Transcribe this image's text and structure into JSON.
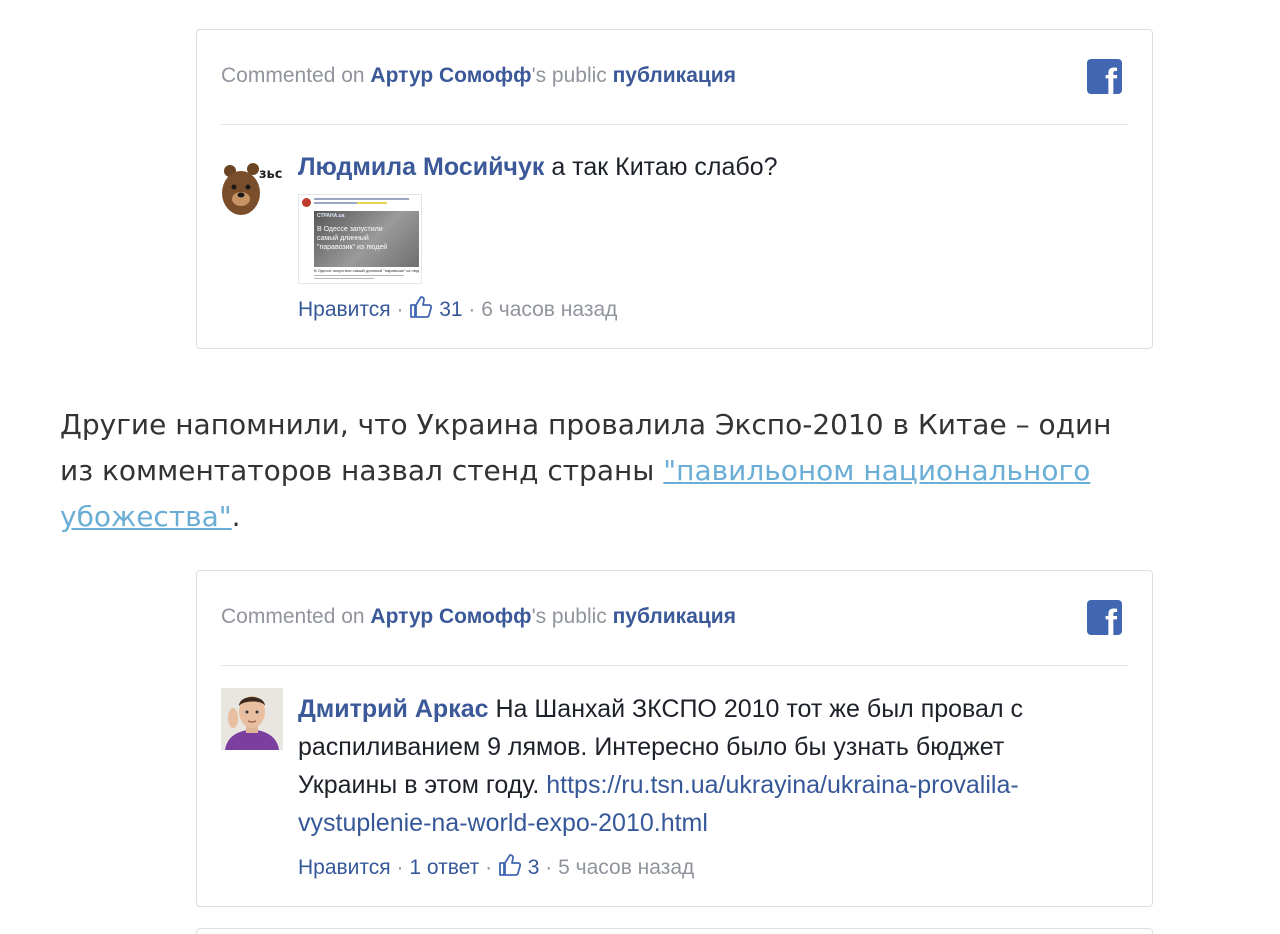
{
  "embed1": {
    "header_prefix": "Commented on",
    "header_page": "Артур Сомофф",
    "header_middle": "'s public",
    "header_post": "публикация",
    "author": "Людмила Мосийчук",
    "text": "а так Китаю слабо?",
    "avatar_text": "зьс",
    "thumbnail": {
      "site": "СТРАНА.ua",
      "overlay": "В Одессе запустили самый длинный \"паравозик\" из людей",
      "caption": "В Одессе запустили самый длинный \"паравозик\" из людей"
    },
    "like_label": "Нравится",
    "sep": "·",
    "like_count": "31",
    "time": "6 часов назад"
  },
  "article": {
    "text_before": "Другие напомнили, что Украина провалила Экспо-2010 в Китае – один из комментаторов назвал стенд страны ",
    "link_text": "\"павильоном национального убожества\"",
    "text_after": "."
  },
  "embed2": {
    "header_prefix": "Commented on",
    "header_page": "Артур Сомофф",
    "header_middle": "'s public",
    "header_post": "публикация",
    "author": "Дмитрий Аркас",
    "text": "На Шанхай ЗКСПО 2010 тот же был провал с распиливанием 9 лямов. Интересно было бы узнать бюджет Украины в этом году.",
    "link": "https://ru.tsn.ua/ukrayina/ukraina-provalila-vystuplenie-na-world-expo-2010.html",
    "like_label": "Нравится",
    "sep": "·",
    "reply_label": "1 ответ",
    "like_count": "3",
    "time": "5 часов назад"
  },
  "colors": {
    "facebook_blue": "#4267b2",
    "link_blue": "#365899",
    "meta_gray": "#90949c",
    "article_link": "#6aaed6"
  },
  "icons": [
    "facebook-logo-icon",
    "thumbs-up-icon"
  ]
}
